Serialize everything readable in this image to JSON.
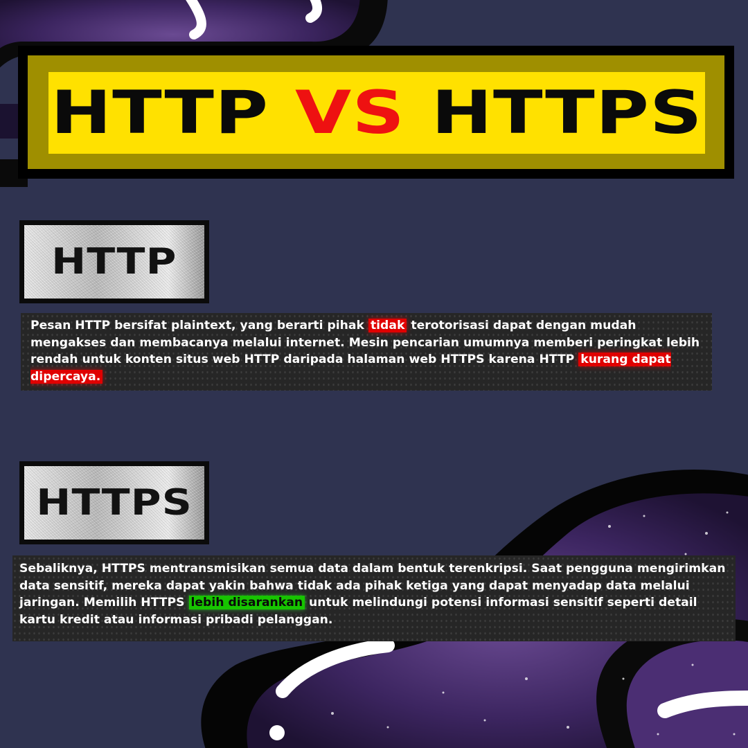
{
  "title": {
    "part1": "HTTP ",
    "part2": "VS",
    "part3": " HTTPS"
  },
  "http": {
    "label": "HTTP",
    "text_before": "Pesan HTTP bersifat plaintext, yang berarti pihak ",
    "highlight1": "tidak",
    "text_middle": " terotorisasi dapat dengan mudah mengakses dan membacanya melalui internet. Mesin pencarian umumnya memberi peringkat lebih rendah untuk konten situs web HTTP daripada halaman web HTTPS karena HTTP ",
    "highlight2": "kurang dapat dipercaya."
  },
  "https": {
    "label": "HTTPS",
    "text_before": "Sebaliknya, HTTPS mentransmisikan semua data dalam bentuk terenkripsi. Saat pengguna mengirimkan data sensitif, mereka dapat yakin bahwa tidak ada pihak ketiga yang dapat menyadap data melalui jaringan. Memilih HTTPS ",
    "highlight": "lebih disarankan",
    "text_after": " untuk melindungi potensi informasi sensitif seperti detail kartu kredit atau informasi pribadi pelanggan."
  },
  "colors": {
    "background": "#2f3350",
    "title_plate": "#ffe100",
    "title_vs": "#ee1111",
    "highlight_red": "#e00000",
    "highlight_green": "#17c400",
    "galaxy_purple": "#4a2d6e"
  }
}
